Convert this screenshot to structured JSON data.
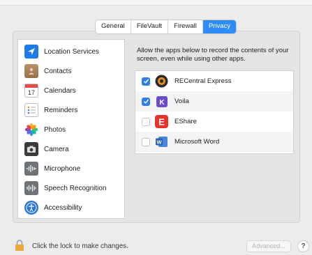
{
  "tabs": [
    {
      "label": "General"
    },
    {
      "label": "FileVault"
    },
    {
      "label": "Firewall"
    },
    {
      "label": "Privacy"
    }
  ],
  "sidebar": {
    "items": [
      {
        "label": "Location Services",
        "icon": "location-arrow-icon"
      },
      {
        "label": "Contacts",
        "icon": "contacts-book-icon"
      },
      {
        "label": "Calendars",
        "icon": "calendar-icon"
      },
      {
        "label": "Reminders",
        "icon": "reminders-icon"
      },
      {
        "label": "Photos",
        "icon": "photos-flower-icon"
      },
      {
        "label": "Camera",
        "icon": "camera-icon"
      },
      {
        "label": "Microphone",
        "icon": "microphone-waveform-icon"
      },
      {
        "label": "Speech Recognition",
        "icon": "speech-waveform-icon"
      },
      {
        "label": "Accessibility",
        "icon": "accessibility-icon"
      }
    ]
  },
  "calendar_icon_day": "17",
  "main": {
    "description": "Allow the apps below to record the contents of your screen, even while using other apps.",
    "apps": [
      {
        "name": "RECentral Express",
        "checked": true,
        "icon": "recentral-icon"
      },
      {
        "name": "Voila",
        "checked": true,
        "icon": "voila-icon"
      },
      {
        "name": "EShare",
        "checked": false,
        "icon": "eshare-icon"
      },
      {
        "name": "Microsoft Word",
        "checked": false,
        "icon": "word-icon"
      }
    ],
    "voila_icon_letter": "K",
    "eshare_icon_letter": "E",
    "word_icon_letter": "W"
  },
  "footer": {
    "lock_text": "Click the lock to make changes.",
    "advanced_label": "Advanced...",
    "help_label": "?"
  },
  "colors": {
    "accent": "#2f8cf6",
    "checkbox_on": "#2f7ff0",
    "eshare": "#e8332a",
    "word": "#2b5fb4",
    "voila": "#6a4cc7"
  }
}
